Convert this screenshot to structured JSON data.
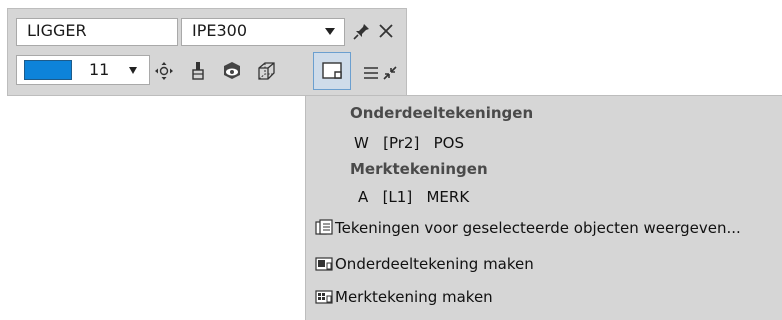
{
  "toolbar": {
    "name_value": "LIGGER",
    "profile_value": "IPE300",
    "color_value": "11",
    "color_hex": "#0d83d9",
    "icons": [
      "move-icon",
      "brush-icon",
      "eye-cube-icon",
      "wireframe-cube-icon",
      "drawing-icon"
    ],
    "pin_icon": "pin-icon",
    "close_icon": "close-icon",
    "list_icon": "list-icon",
    "collapse_icon": "collapse-arrows-icon"
  },
  "menu": {
    "section1_title": "Onderdeeltekeningen",
    "section1_entry": "W   [Pr2]   POS",
    "section2_title": "Merktekeningen",
    "section2_entry": "A   [L1]   MERK",
    "actions": [
      {
        "icon": "drawings-list-icon",
        "label": "Tekeningen voor geselecteerde objecten weergeven..."
      },
      {
        "icon": "part-drawing-icon",
        "label": "Onderdeeltekening maken"
      },
      {
        "icon": "assembly-drawing-icon",
        "label": "Merktekening maken"
      }
    ]
  }
}
